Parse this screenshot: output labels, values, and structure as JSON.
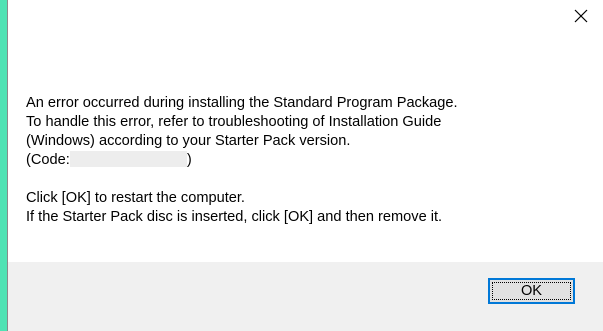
{
  "dialog": {
    "close_icon": "close-icon",
    "message_lines": [
      "An error occurred during installing the Standard Program Package.",
      "To handle this error, refer to troubleshooting of Installation Guide",
      "(Windows) according to your Starter Pack version."
    ],
    "code_prefix": "(Code:",
    "code_suffix": ")",
    "instruction_lines": [
      "Click [OK] to restart the computer.",
      "If the Starter Pack disc is inserted, click [OK] and then remove it."
    ],
    "ok_label": "OK"
  },
  "colors": {
    "background": "#4fe3b4",
    "dialog": "#ffffff",
    "footer": "#f0f0f0",
    "button_focus": "#0078d7"
  }
}
